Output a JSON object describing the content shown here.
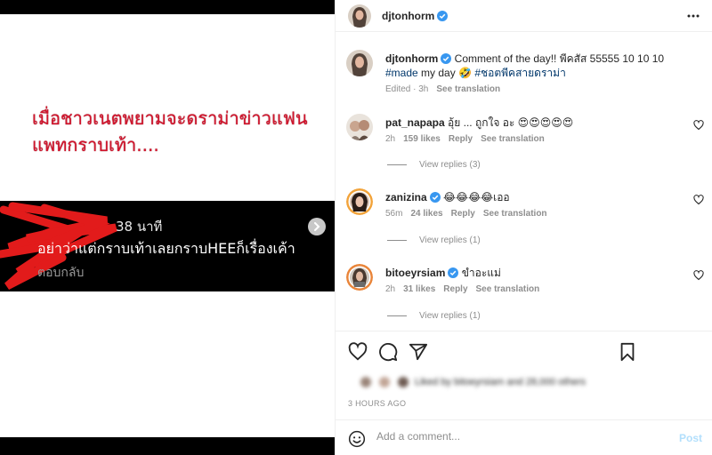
{
  "media": {
    "headline": "เมื่อชาวเนตพยามจะดราม่าข่าวแฟนแพทกราบเท้า....",
    "shot_time": "38 นาที",
    "shot_text": "อย่าว่าแต่กราบเท้าเลยกราบHEEก็เรื่องเค้า",
    "shot_reply": "ตอบกลับ"
  },
  "header": {
    "username": "djtonhorm"
  },
  "caption": {
    "username": "djtonhorm",
    "text": "Comment of the day!! พีคสัส 55555 10 10 10",
    "hashtag1": "#made",
    "middle": " my day 🤣 ",
    "hashtag2": "#ชอตพีคสายดราม่า",
    "edited": "Edited · 3h",
    "see_translation": "See translation"
  },
  "comments": [
    {
      "username": "pat_napapa",
      "text": "อุ้ย ... ถูกใจ อะ 😍😍😍😍😍",
      "time": "2h",
      "likes": "159 likes",
      "reply": "Reply",
      "translate": "See translation",
      "replies": "View replies (3)"
    },
    {
      "username": "zanizina",
      "text": "😂😂😂😂เออ",
      "time": "56m",
      "likes": "24 likes",
      "reply": "Reply",
      "translate": "See translation",
      "replies": "View replies (1)"
    },
    {
      "username": "bitoeyrsiam",
      "text": "ขำอะแม่",
      "time": "2h",
      "likes": "31 likes",
      "reply": "Reply",
      "translate": "See translation",
      "replies": "View replies (1)"
    }
  ],
  "actions": {
    "liked_by": "Liked by bitoeyrsiam and 28,000 others",
    "timestamp": "3 HOURS AGO"
  },
  "add_comment": {
    "placeholder": "Add a comment...",
    "post": "Post"
  },
  "colors": {
    "verified": "#3897f0",
    "link": "#00376b",
    "muted": "#8e8e8e",
    "post_disabled": "#b2dffc",
    "headline_red": "#d3132b"
  },
  "icons": [
    "verified-badge-icon",
    "more-options-icon",
    "heart-icon",
    "comment-icon",
    "share-icon",
    "bookmark-icon",
    "emoji-icon",
    "chevron-right-icon"
  ]
}
